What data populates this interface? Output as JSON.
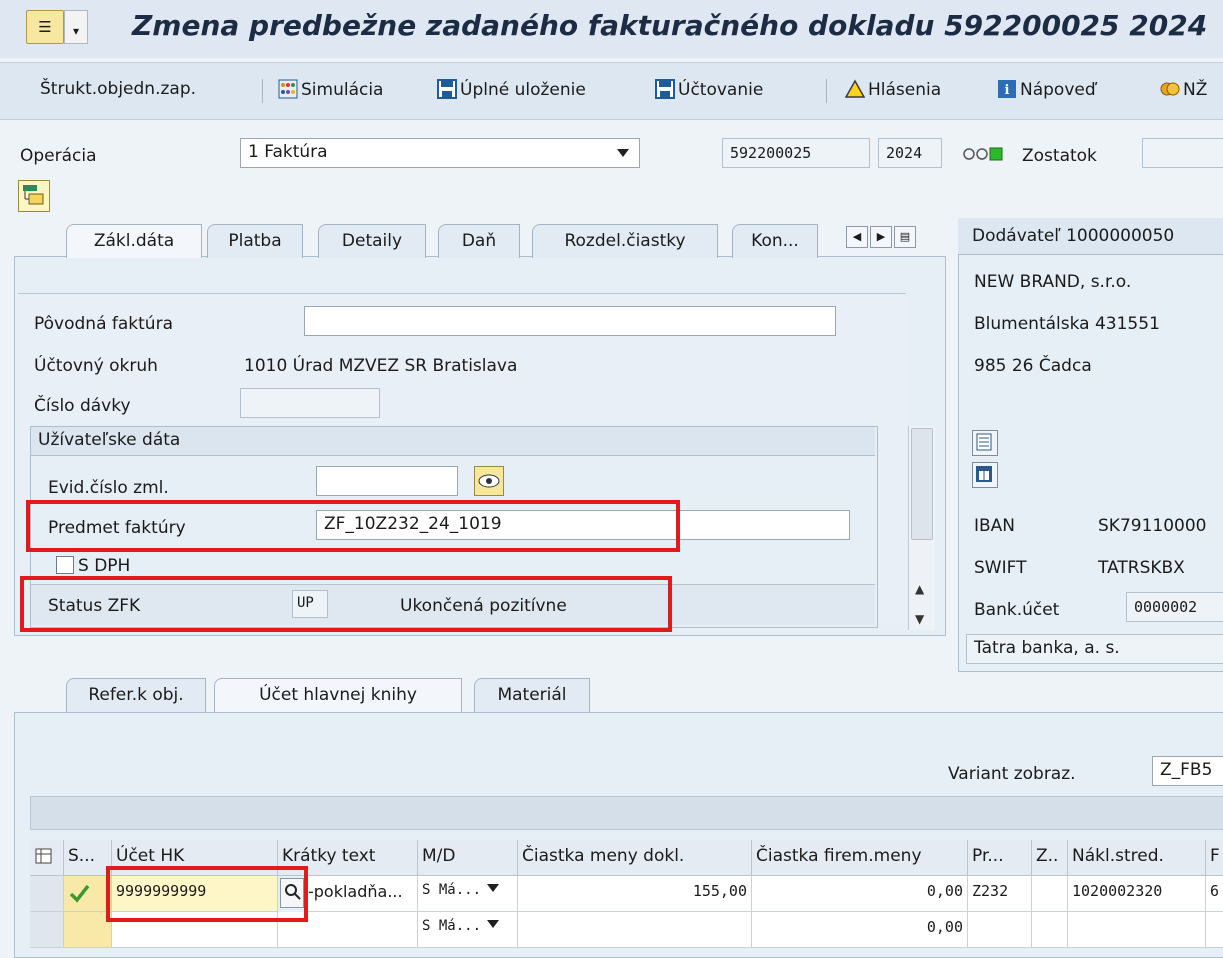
{
  "title": "Zmena predbežne zadaného fakturačného dokladu 592200025 2024",
  "toolbar": {
    "strukt": "Štrukt.objedn.zap.",
    "simulacia": "Simulácia",
    "uplne_ulozenie": "Úplné uloženie",
    "uctovanie": "Účtovanie",
    "hlasenia": "Hlásenia",
    "napoved": "Nápoveď",
    "cut_item": "NŽ"
  },
  "header": {
    "operacia_label": "Operácia",
    "operacia_value": "1 Faktúra",
    "doc_number": "592200025",
    "doc_year": "2024",
    "zostatok_label": "Zostatok"
  },
  "tabs_top": [
    "Zákl.dáta",
    "Platba",
    "Detaily",
    "Daň",
    "Rozdel.čiastky",
    "Kon..."
  ],
  "basic": {
    "povodna_faktura_label": "Pôvodná faktúra",
    "povodna_faktura_value": "",
    "uctovny_okruh_label": "Účtovný okruh",
    "uctovny_okruh_value": "1010 Úrad MZVEZ SR Bratislava",
    "cislo_davky_label": "Číslo dávky",
    "cislo_davky_value": "",
    "user_group_title": "Užívateľske dáta",
    "evid_label": "Evid.číslo zml.",
    "evid_value": "",
    "predmet_label": "Predmet faktúry",
    "predmet_value": "ZF_10Z232_24_1019",
    "sdph_label": "S DPH",
    "status_label": "Status ZFK",
    "status_code": "UP",
    "status_text": "Ukončená pozitívne"
  },
  "vendor": {
    "header": "Dodávateľ 1000000050",
    "name": "NEW BRAND, s.r.o.",
    "street": "Blumentálska 431551",
    "city": "985 26 Čadca",
    "iban_label": "IBAN",
    "iban_value": "SK79110000",
    "swift_label": "SWIFT",
    "swift_value": "TATRSKBX",
    "bank_label": "Bank.účet",
    "bank_value": "0000002",
    "bank_name": "Tatra banka, a. s."
  },
  "tabs_bottom": [
    "Refer.k obj.",
    "Účet hlavnej knihy",
    "Materiál"
  ],
  "variant": {
    "label": "Variant zobraz.",
    "value": "Z_FB5"
  },
  "grid": {
    "headers": [
      "S...",
      "Účet HK",
      "Krátky text",
      "M/D",
      "Čiastka meny dokl.",
      "Čiastka firem.meny",
      "Pr...",
      "Z..",
      "Nákl.stred.",
      "F"
    ],
    "rows": [
      {
        "ucet": "9999999999",
        "text": "-pokladňa...",
        "md": "S Má...",
        "amount_doc": "155,00",
        "amount_firm": "0,00",
        "pr": "Z232",
        "z": "",
        "nakl": "1020002320",
        "f": "6"
      },
      {
        "ucet": "",
        "text": "",
        "md": "S Má...",
        "amount_doc": "",
        "amount_firm": "0,00",
        "pr": "",
        "z": "",
        "nakl": "",
        "f": ""
      }
    ]
  },
  "colors": {
    "highlight": "#e11b1b",
    "input_bg": "#ffffff",
    "panel_bg": "#e6eef6",
    "accent_yellow": "#f9ec9e"
  }
}
